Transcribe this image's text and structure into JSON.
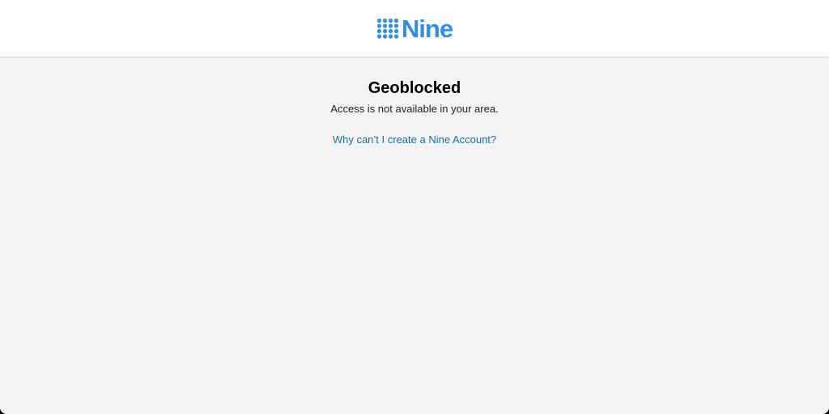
{
  "header": {
    "logo_text": "Nine",
    "logo_icon": "nine-dots-icon",
    "brand_color": "#2f8fe6"
  },
  "main": {
    "title": "Geoblocked",
    "message": "Access is not available in your area.",
    "help_link": "Why can’t I create a Nine Account?",
    "link_color": "#1f6f9a"
  }
}
